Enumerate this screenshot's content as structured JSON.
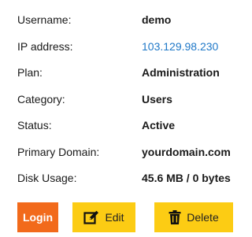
{
  "details": [
    {
      "label": "Username:",
      "value": "demo"
    },
    {
      "label": "IP address:",
      "value": "103.129.98.230"
    },
    {
      "label": "Plan:",
      "value": "Administration"
    },
    {
      "label": "Category:",
      "value": "Users"
    },
    {
      "label": "Status:",
      "value": "Active"
    },
    {
      "label": "Primary Domain:",
      "value": "yourdomain.com"
    },
    {
      "label": "Disk Usage:",
      "value": "45.6 MB / 0 bytes"
    }
  ],
  "actions": {
    "login_label": "Login",
    "edit_label": "Edit",
    "delete_label": "Delete",
    "edit_icon": "edit-icon",
    "delete_icon": "trash-icon"
  },
  "colors": {
    "login_bg": "#f26a1b",
    "action_bg": "#fccc14",
    "link": "#1f78c8"
  }
}
